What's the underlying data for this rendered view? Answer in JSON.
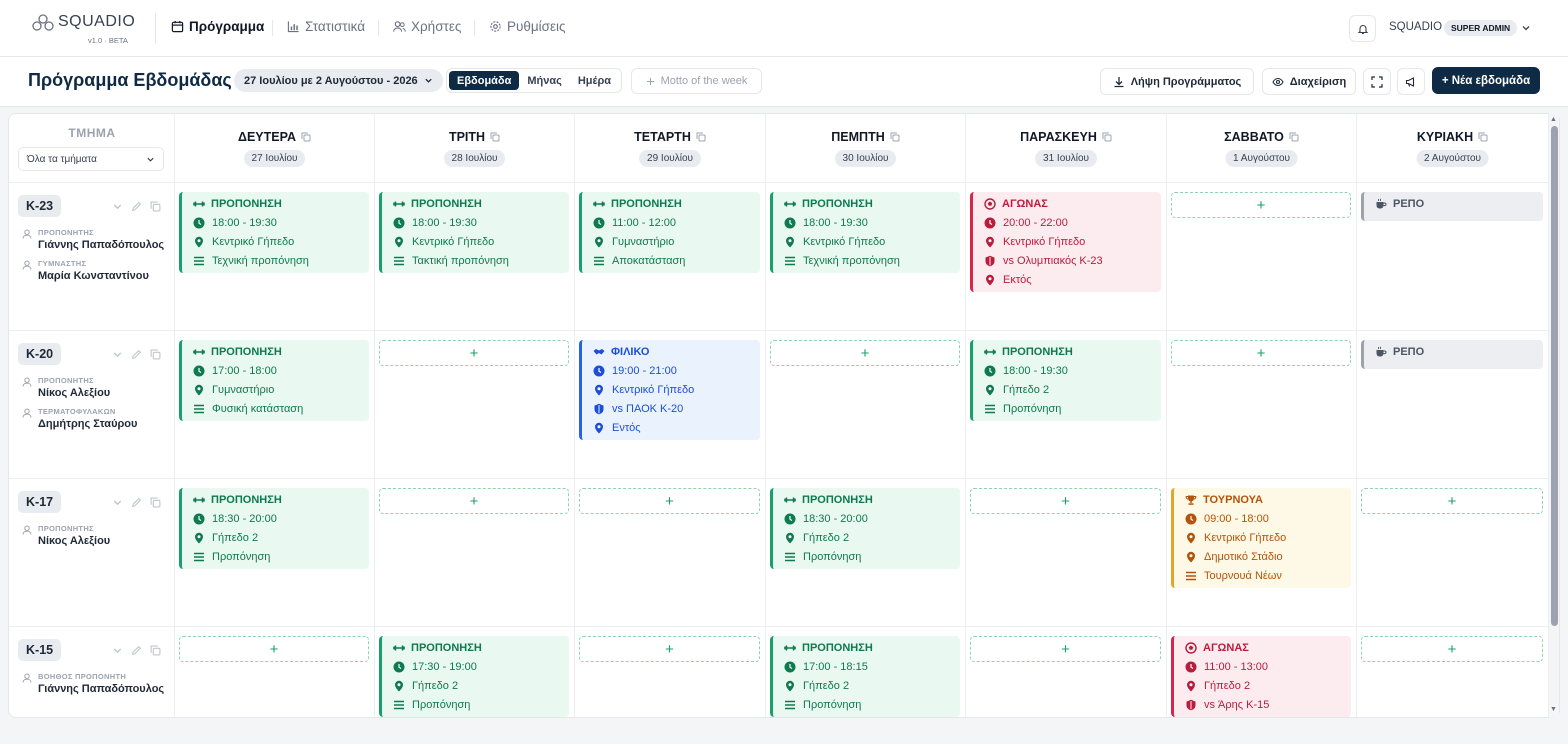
{
  "app": {
    "name": "SQUADIO",
    "version": "v1.0 · BETA"
  },
  "nav": {
    "items": [
      {
        "label": "Πρόγραμμα",
        "active": true
      },
      {
        "label": "Στατιστικά",
        "active": false
      },
      {
        "label": "Χρήστες",
        "active": false
      },
      {
        "label": "Ρυθμίσεις",
        "active": false
      }
    ]
  },
  "user": {
    "name": "SQUADIO",
    "role": "SUPER ADMIN"
  },
  "toolbar": {
    "title": "Πρόγραμμα Εβδομάδας",
    "date_range": "27 Ιουλίου με 2 Αυγούστου - 2026",
    "views": [
      "Εβδομάδα",
      "Μήνας",
      "Ημέρα"
    ],
    "active_view": "Εβδομάδα",
    "motto_placeholder": "Motto of the week",
    "download_label": "Λήψη Προγράμματος",
    "manage_label": "Διαχείριση",
    "new_week_label": "+ Νέα εβδομάδα"
  },
  "grid": {
    "team_header": "ΤΜΗΜΑ",
    "team_filter": "Όλα τα τμήματα",
    "days": [
      {
        "name": "ΔΕΥΤΕΡΑ",
        "date": "27 Ιουλίου"
      },
      {
        "name": "ΤΡΙΤΗ",
        "date": "28 Ιουλίου"
      },
      {
        "name": "ΤΕΤΑΡΤΗ",
        "date": "29 Ιουλίου"
      },
      {
        "name": "ΠΕΜΠΤΗ",
        "date": "30 Ιουλίου"
      },
      {
        "name": "ΠΑΡΑΣΚΕΥΗ",
        "date": "31 Ιουλίου"
      },
      {
        "name": "ΣΑΒΒΑΤΟ",
        "date": "1 Αυγούστου"
      },
      {
        "name": "ΚΥΡΙΑΚΗ",
        "date": "2 Αυγούστου"
      }
    ],
    "rows": [
      {
        "team": "K-23",
        "staff": [
          {
            "role": "ΠΡΟΠΟΝΗΤΗΣ",
            "name": "Γιάννης Παπαδόπουλος"
          },
          {
            "role": "ΓΥΜΝΑΣΤΗΣ",
            "name": "Μαρία Κωνσταντίνου"
          }
        ],
        "cells": [
          {
            "kind": "training",
            "title": "ΠΡΟΠΟΝΗΣΗ",
            "time": "18:00 - 19:30",
            "place": "Κεντρικό Γήπεδο",
            "note": "Τεχνική προπόνηση"
          },
          {
            "kind": "training",
            "title": "ΠΡΟΠΟΝΗΣΗ",
            "time": "18:00 - 19:30",
            "place": "Κεντρικό Γήπεδο",
            "note": "Τακτική προπόνηση"
          },
          {
            "kind": "training",
            "title": "ΠΡΟΠΟΝΗΣΗ",
            "time": "11:00 - 12:00",
            "place": "Γυμναστήριο",
            "note": "Αποκατάσταση"
          },
          {
            "kind": "training",
            "title": "ΠΡΟΠΟΝΗΣΗ",
            "time": "18:00 - 19:30",
            "place": "Κεντρικό Γήπεδο",
            "note": "Τεχνική προπόνηση"
          },
          {
            "kind": "match",
            "title": "ΑΓΩΝΑΣ",
            "time": "20:00 - 22:00",
            "place": "Κεντρικό Γήπεδο",
            "opponent": "vs Ολυμπιακός Κ-23",
            "venue": "Εκτός"
          },
          {
            "kind": "empty"
          },
          {
            "kind": "rest",
            "title": "ΡΕΠΟ"
          }
        ]
      },
      {
        "team": "K-20",
        "staff": [
          {
            "role": "ΠΡΟΠΟΝΗΤΗΣ",
            "name": "Νίκος Αλεξίου"
          },
          {
            "role": "ΤΕΡΜΑΤΟΦΥΛΑΚΩΝ",
            "name": "Δημήτρης Σταύρου"
          }
        ],
        "cells": [
          {
            "kind": "training",
            "title": "ΠΡΟΠΟΝΗΣΗ",
            "time": "17:00 - 18:00",
            "place": "Γυμναστήριο",
            "note": "Φυσική κατάσταση"
          },
          {
            "kind": "empty"
          },
          {
            "kind": "friendly",
            "title": "ΦΙΛΙΚΟ",
            "time": "19:00 - 21:00",
            "place": "Κεντρικό Γήπεδο",
            "opponent": "vs ΠΑΟΚ Κ-20",
            "venue": "Εντός"
          },
          {
            "kind": "empty"
          },
          {
            "kind": "training",
            "title": "ΠΡΟΠΟΝΗΣΗ",
            "time": "18:00 - 19:30",
            "place": "Γήπεδο 2",
            "note": "Προπόνηση"
          },
          {
            "kind": "empty"
          },
          {
            "kind": "rest",
            "title": "ΡΕΠΟ"
          }
        ]
      },
      {
        "team": "K-17",
        "staff": [
          {
            "role": "ΠΡΟΠΟΝΗΤΗΣ",
            "name": "Νίκος Αλεξίου"
          }
        ],
        "cells": [
          {
            "kind": "training",
            "title": "ΠΡΟΠΟΝΗΣΗ",
            "time": "18:30 - 20:00",
            "place": "Γήπεδο 2",
            "note": "Προπόνηση"
          },
          {
            "kind": "empty"
          },
          {
            "kind": "empty"
          },
          {
            "kind": "training",
            "title": "ΠΡΟΠΟΝΗΣΗ",
            "time": "18:30 - 20:00",
            "place": "Γήπεδο 2",
            "note": "Προπόνηση"
          },
          {
            "kind": "empty"
          },
          {
            "kind": "tournament",
            "title": "ΤΟΥΡΝΟΥΑ",
            "time": "09:00 - 18:00",
            "place": "Κεντρικό Γήπεδο",
            "place2": "Δημοτικό Στάδιο",
            "note": "Τουρνουά Νέων"
          },
          {
            "kind": "empty"
          }
        ]
      },
      {
        "team": "K-15",
        "staff": [
          {
            "role": "ΒΟΗΘΟΣ ΠΡΟΠΟΝΗΤΗ",
            "name": "Γιάννης Παπαδόπουλος"
          }
        ],
        "cells": [
          {
            "kind": "empty"
          },
          {
            "kind": "training",
            "title": "ΠΡΟΠΟΝΗΣΗ",
            "time": "17:30 - 19:00",
            "place": "Γήπεδο 2",
            "note": "Προπόνηση"
          },
          {
            "kind": "empty"
          },
          {
            "kind": "training",
            "title": "ΠΡΟΠΟΝΗΣΗ",
            "time": "17:00 - 18:15",
            "place": "Γήπεδο 2",
            "note": "Προπόνηση"
          },
          {
            "kind": "empty"
          },
          {
            "kind": "match",
            "title": "ΑΓΩΝΑΣ",
            "time": "11:00 - 13:00",
            "place": "Γήπεδο 2",
            "opponent": "vs Άρης Κ-15"
          },
          {
            "kind": "empty"
          }
        ]
      }
    ]
  },
  "icons": {
    "training": "dumbbell-icon",
    "match": "soccer-ball-icon",
    "friendly": "handshake-icon",
    "tournament": "trophy-icon",
    "rest": "coffee-icon",
    "time": "clock-icon",
    "place": "map-pin-icon",
    "note": "list-icon",
    "opponent": "shield-icon"
  },
  "colors": {
    "primary": "#0f2a44",
    "training": "#18a06a",
    "match": "#d8254a",
    "friendly": "#2563eb",
    "tournament": "#e0a62a",
    "rest": "#9ca3af"
  }
}
